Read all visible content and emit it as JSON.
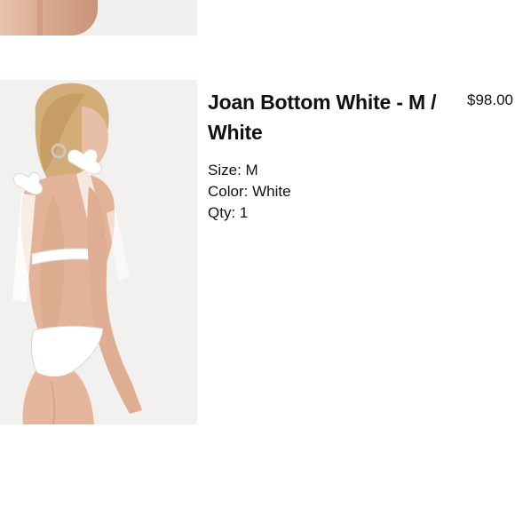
{
  "previous_item": {
    "image_icon": "cropped-product-photo"
  },
  "item": {
    "image_icon": "model-wearing-white-bikini-photo",
    "title": "Joan Bottom White - M / White",
    "price": "$98.00",
    "size_label": "Size:",
    "size_value": "M",
    "color_label": "Color:",
    "color_value": "White",
    "qty_label": "Qty:",
    "qty_value": "1"
  },
  "colors": {
    "background": "#ffffff",
    "text": "#111111",
    "image_background": "#f2f1ef"
  }
}
